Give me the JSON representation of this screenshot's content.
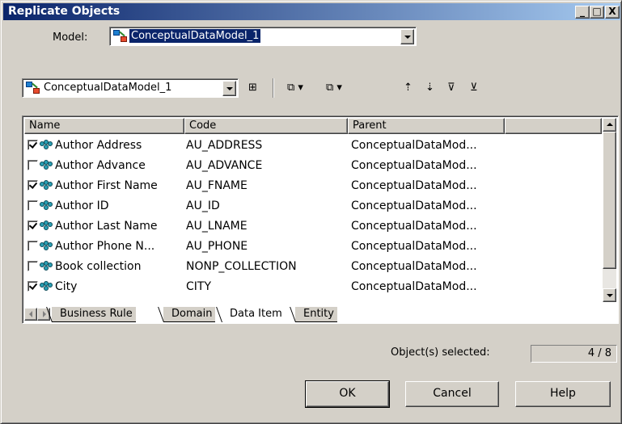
{
  "window": {
    "title": "Replicate Objects",
    "buttons": [
      "_",
      "□",
      "X"
    ]
  },
  "model_row": {
    "label": "Model:",
    "value": "ConceptualDataModel_1"
  },
  "toolbar": {
    "model_combo_value": "ConceptualDataModel_1",
    "icons": [
      "tree-view-icon",
      "select-all-icon",
      "deselect-all-icon",
      "move-up-icon",
      "move-down-icon",
      "filter-icon",
      "clear-filter-icon"
    ]
  },
  "list": {
    "columns": [
      "Name",
      "Code",
      "Parent"
    ],
    "rows": [
      {
        "checked": true,
        "name": "Author Address",
        "code": "AU_ADDRESS",
        "parent": "ConceptualDataMod..."
      },
      {
        "checked": false,
        "name": "Author Advance",
        "code": "AU_ADVANCE",
        "parent": "ConceptualDataMod..."
      },
      {
        "checked": true,
        "name": "Author First Name",
        "code": "AU_FNAME",
        "parent": "ConceptualDataMod..."
      },
      {
        "checked": false,
        "name": "Author ID",
        "code": "AU_ID",
        "parent": "ConceptualDataMod..."
      },
      {
        "checked": true,
        "name": "Author Last Name",
        "code": "AU_LNAME",
        "parent": "ConceptualDataMod..."
      },
      {
        "checked": false,
        "name": "Author Phone N...",
        "code": "AU_PHONE",
        "parent": "ConceptualDataMod..."
      },
      {
        "checked": false,
        "name": "Book collection",
        "code": "NONP_COLLECTION",
        "parent": "ConceptualDataMod..."
      },
      {
        "checked": true,
        "name": "City",
        "code": "CITY",
        "parent": "ConceptualDataMod..."
      }
    ]
  },
  "tabs": [
    {
      "label": "Business Rule",
      "active": false
    },
    {
      "label": "Domain",
      "active": false
    },
    {
      "label": "Data Item",
      "active": true
    },
    {
      "label": "Entity",
      "active": false
    }
  ],
  "status": {
    "label": "Object(s) selected:",
    "value": "4 / 8"
  },
  "footer": {
    "ok_label": "OK",
    "cancel_label": "Cancel",
    "help_label": "Help"
  },
  "colors": {
    "title_start": "#0a246a",
    "title_end": "#a6caf0",
    "face": "#d4d0c8",
    "selection": "#0a246a"
  }
}
